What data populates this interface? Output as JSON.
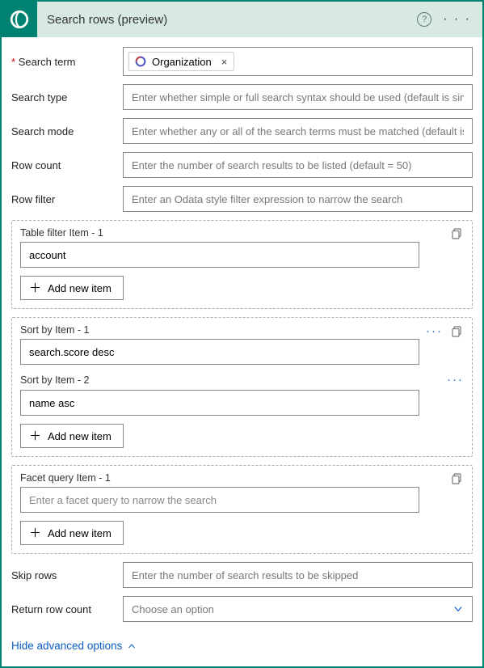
{
  "header": {
    "title": "Search rows (preview)"
  },
  "fields": {
    "search_term": {
      "label": "Search term",
      "token": "Organization"
    },
    "search_type": {
      "label": "Search type",
      "placeholder": "Enter whether simple or full search syntax should be used (default is simple)"
    },
    "search_mode": {
      "label": "Search mode",
      "placeholder": "Enter whether any or all of the search terms must be matched (default is any)"
    },
    "row_count": {
      "label": "Row count",
      "placeholder": "Enter the number of search results to be listed (default = 50)"
    },
    "row_filter": {
      "label": "Row filter",
      "placeholder": "Enter an Odata style filter expression to narrow the search"
    },
    "skip_rows": {
      "label": "Skip rows",
      "placeholder": "Enter the number of search results to be skipped"
    },
    "return_row_count": {
      "label": "Return row count",
      "placeholder": "Choose an option"
    }
  },
  "groups": {
    "table_filter": {
      "items": [
        {
          "label": "Table filter Item - 1",
          "value": "account"
        }
      ],
      "add_label": "Add new item"
    },
    "sort_by": {
      "items": [
        {
          "label": "Sort by Item - 1",
          "value": "search.score desc"
        },
        {
          "label": "Sort by Item - 2",
          "value": "name asc"
        }
      ],
      "add_label": "Add new item"
    },
    "facet_query": {
      "items": [
        {
          "label": "Facet query Item - 1",
          "value": "",
          "placeholder": "Enter a facet query to narrow the search"
        }
      ],
      "add_label": "Add new item"
    }
  },
  "advanced_link": "Hide advanced options"
}
